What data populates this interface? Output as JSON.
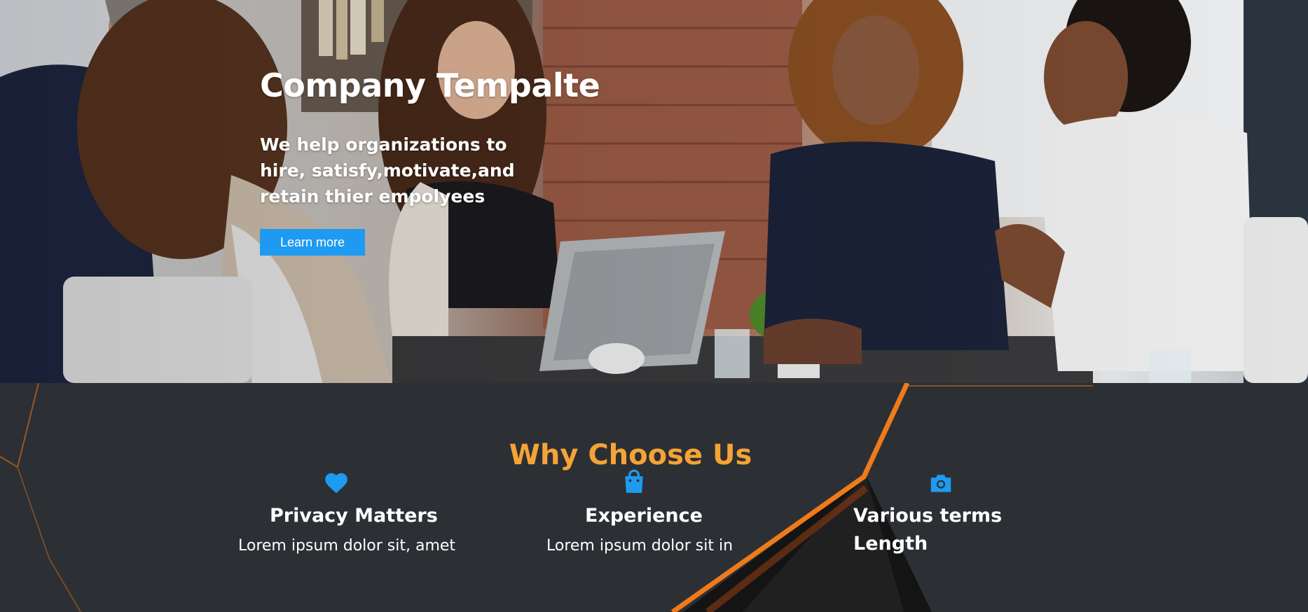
{
  "hero": {
    "title": "Company Tempalte",
    "subtitle": "We help organizations to hire, satisfy,motivate,and retain thier empolyees",
    "button_label": "Learn more"
  },
  "features": {
    "heading": "Why Choose Us",
    "items": [
      {
        "icon": "heart-icon",
        "title": "Privacy Matters",
        "text": "Lorem ipsum dolor sit, amet"
      },
      {
        "icon": "shopping-bag-icon",
        "title": "Experience",
        "text": "Lorem ipsum dolor sit in"
      },
      {
        "icon": "camera-icon",
        "title": "Various terms Length",
        "text": ""
      }
    ]
  },
  "colors": {
    "accent": "#1e9bf0",
    "heading": "#f5a336",
    "dark_bg": "#2c3034",
    "stripe": "#f07a1a"
  }
}
